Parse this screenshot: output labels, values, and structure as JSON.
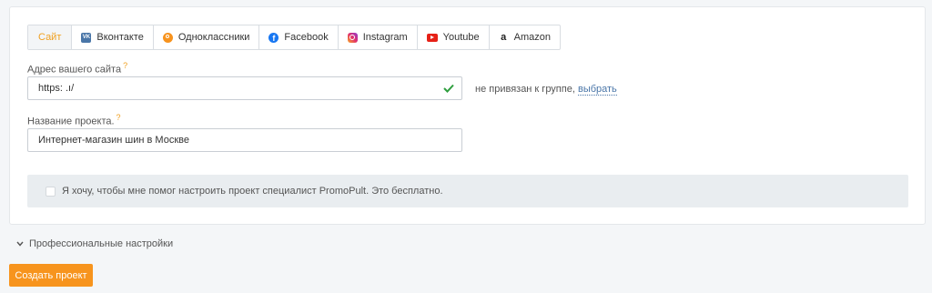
{
  "tabs": [
    {
      "label": "Сайт",
      "icon": ""
    },
    {
      "label": "Вконтакте",
      "icon": "vk-icon"
    },
    {
      "label": "Одноклассники",
      "icon": "odnoklassniki-icon"
    },
    {
      "label": "Facebook",
      "icon": "facebook-icon"
    },
    {
      "label": "Instagram",
      "icon": "instagram-icon"
    },
    {
      "label": "Youtube",
      "icon": "youtube-icon"
    },
    {
      "label": "Amazon",
      "icon": "amazon-icon"
    }
  ],
  "active_tab": "Сайт",
  "site_url": {
    "label": "Адрес вашего сайта",
    "help_mark": "?",
    "value": "https:            .ı/",
    "valid_icon": "check-icon",
    "note_text": "не привязан к группе,",
    "note_link": "выбрать"
  },
  "project_name": {
    "label": "Название проекта.",
    "help_mark": "?",
    "value": "Интернет-магазин шин в Москве"
  },
  "help_checkbox": {
    "text": "Я хочу, чтобы мне помог настроить проект специалист PromoPult. Это бесплатно.",
    "checked": false
  },
  "professional_settings": {
    "label": "Профессиональные настройки",
    "icon": "chevron-down-icon"
  },
  "create_button": {
    "label": "Создать проект"
  },
  "colors": {
    "accent": "#f7941d",
    "active_tab_text": "#f0a020",
    "valid_check": "#2e9e3e",
    "link": "#4a76a8"
  }
}
